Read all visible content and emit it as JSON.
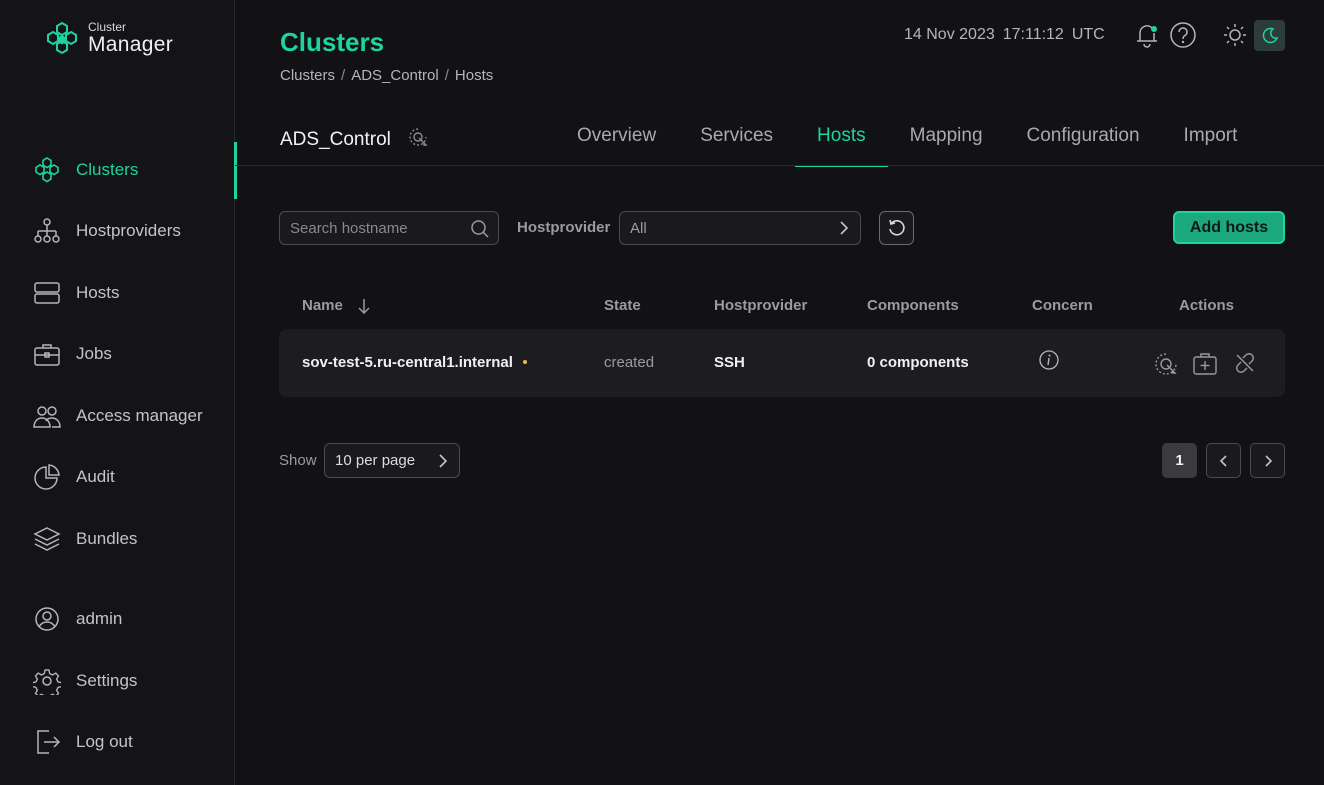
{
  "app": {
    "logo_small": "Cluster",
    "logo_big": "Manager",
    "accent_color": "#1dd3a0",
    "warning_color": "#f0b545"
  },
  "sidebar": {
    "items": [
      {
        "label": "Clusters",
        "icon": "clusters-icon",
        "active": true
      },
      {
        "label": "Hostproviders",
        "icon": "hierarchy-icon"
      },
      {
        "label": "Hosts",
        "icon": "server-icon"
      },
      {
        "label": "Jobs",
        "icon": "briefcase-icon"
      },
      {
        "label": "Access manager",
        "icon": "users-icon"
      },
      {
        "label": "Audit",
        "icon": "pie-chart-icon"
      },
      {
        "label": "Bundles",
        "icon": "layers-icon"
      }
    ],
    "user": {
      "label": "admin",
      "icon": "user-icon"
    },
    "settings": {
      "label": "Settings",
      "icon": "gear-icon"
    },
    "logout": {
      "label": "Log out",
      "icon": "logout-icon"
    }
  },
  "header": {
    "title": "Clusters",
    "breadcrumb": [
      "Clusters",
      "ADS_Control",
      "Hosts"
    ],
    "date": "14 Nov 2023",
    "time": "17:11:12",
    "tz": "UTC"
  },
  "cluster": {
    "name": "ADS_Control",
    "tabs": [
      "Overview",
      "Services",
      "Hosts",
      "Mapping",
      "Configuration",
      "Import"
    ],
    "active_tab": "Hosts"
  },
  "toolbar": {
    "search_placeholder": "Search hostname",
    "hostprovider_label": "Hostprovider",
    "hostprovider_value": "All",
    "add_label": "Add hosts"
  },
  "table": {
    "columns": [
      "Name",
      "State",
      "Hostprovider",
      "Components",
      "Concern",
      "Actions"
    ],
    "rows": [
      {
        "name": "sov-test-5.ru-central1.internal",
        "state": "created",
        "hostprovider": "SSH",
        "components": "0 components"
      }
    ]
  },
  "pagination": {
    "show_label": "Show",
    "per_page": "10 per page",
    "current_page": "1"
  }
}
